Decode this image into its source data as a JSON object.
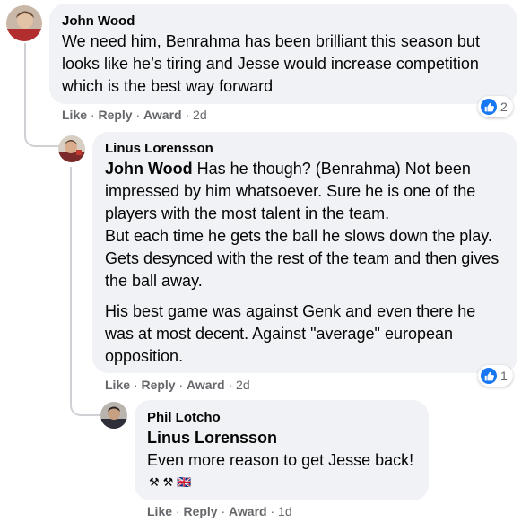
{
  "comments": [
    {
      "author": "John Wood",
      "paragraphs": [
        "We need him, Benrahma has been brilliant this season but looks like he’s tiring and Jesse would increase competition which is the best way forward"
      ],
      "actions": {
        "like": "Like",
        "reply": "Reply",
        "award": "Award",
        "time": "2d"
      },
      "reactions": {
        "icon": "thumbs-up-icon",
        "count": "2"
      }
    },
    {
      "author": "Linus Lorensson",
      "mention": "John Wood",
      "first_line_rest": " Has he though? (Benrahma) Not been impressed by him whatsoever. Sure he is one of the players with the most talent in the team.",
      "paragraphs": [
        "But each time he gets the ball he slows down the play. Gets desynced with the rest of the team and then gives the ball away.",
        "His best game was against Genk and even there he was at most decent. Against \"average\" european opposition."
      ],
      "actions": {
        "like": "Like",
        "reply": "Reply",
        "award": "Award",
        "time": "2d"
      },
      "reactions": {
        "icon": "thumbs-up-icon",
        "count": "1"
      }
    },
    {
      "author": "Phil Lotcho",
      "mention": "Linus Lorensson",
      "paragraphs": [
        "Even more reason to get Jesse back!"
      ],
      "emojis": [
        "⚒",
        "⚒",
        "🇬🇧"
      ],
      "actions": {
        "like": "Like",
        "reply": "Reply",
        "award": "Award",
        "time": "1d"
      }
    }
  ],
  "separator": " · ",
  "colors": {
    "bubble": "#f0f2f5",
    "meta": "#65676b",
    "like_blue": "#1877f2",
    "thread_line": "#ced0d4"
  }
}
